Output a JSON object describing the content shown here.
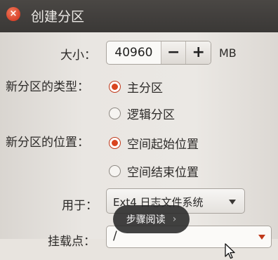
{
  "window": {
    "title": "创建分区",
    "close_icon": "close-icon",
    "close_glyph": "×"
  },
  "size": {
    "label": "大小：",
    "value": "40960",
    "minus": "−",
    "plus": "+",
    "unit": "MB"
  },
  "partition_type": {
    "label": "新分区的类型：",
    "options": [
      {
        "label": "主分区",
        "selected": true
      },
      {
        "label": "逻辑分区",
        "selected": false
      }
    ]
  },
  "partition_location": {
    "label": "新分区的位置：",
    "options": [
      {
        "label": "空间起始位置",
        "selected": true
      },
      {
        "label": "空间结束位置",
        "selected": false
      }
    ]
  },
  "use_as": {
    "label": "用于：",
    "value": "Ext4 日志文件系统",
    "icon": "chevron-down-icon"
  },
  "mount_point": {
    "label": "挂载点：",
    "value": "/",
    "icon": "chevron-down-icon"
  },
  "overlay": {
    "label": "步骤阅读",
    "chevron": "›"
  },
  "colors": {
    "accent": "#d9441f",
    "titlebar": "#3f3d3b"
  }
}
